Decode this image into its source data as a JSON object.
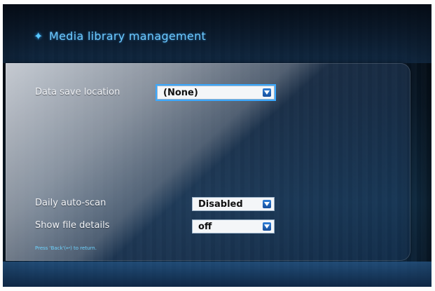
{
  "header": {
    "title": "Media library management",
    "title_icon": "sparkle-icon",
    "accent_color": "#6cc9ff"
  },
  "settings": {
    "data_save_location": {
      "label": "Data save location",
      "value": "(None)"
    },
    "daily_auto_scan": {
      "label": "Daily auto-scan",
      "value": "Disabled"
    },
    "show_file_details": {
      "label": "Show file details",
      "value": "off"
    }
  },
  "footer": {
    "hint": "Press 'Back'(↩) to return."
  },
  "icons": {
    "dropdown": "chevron-down-icon"
  }
}
